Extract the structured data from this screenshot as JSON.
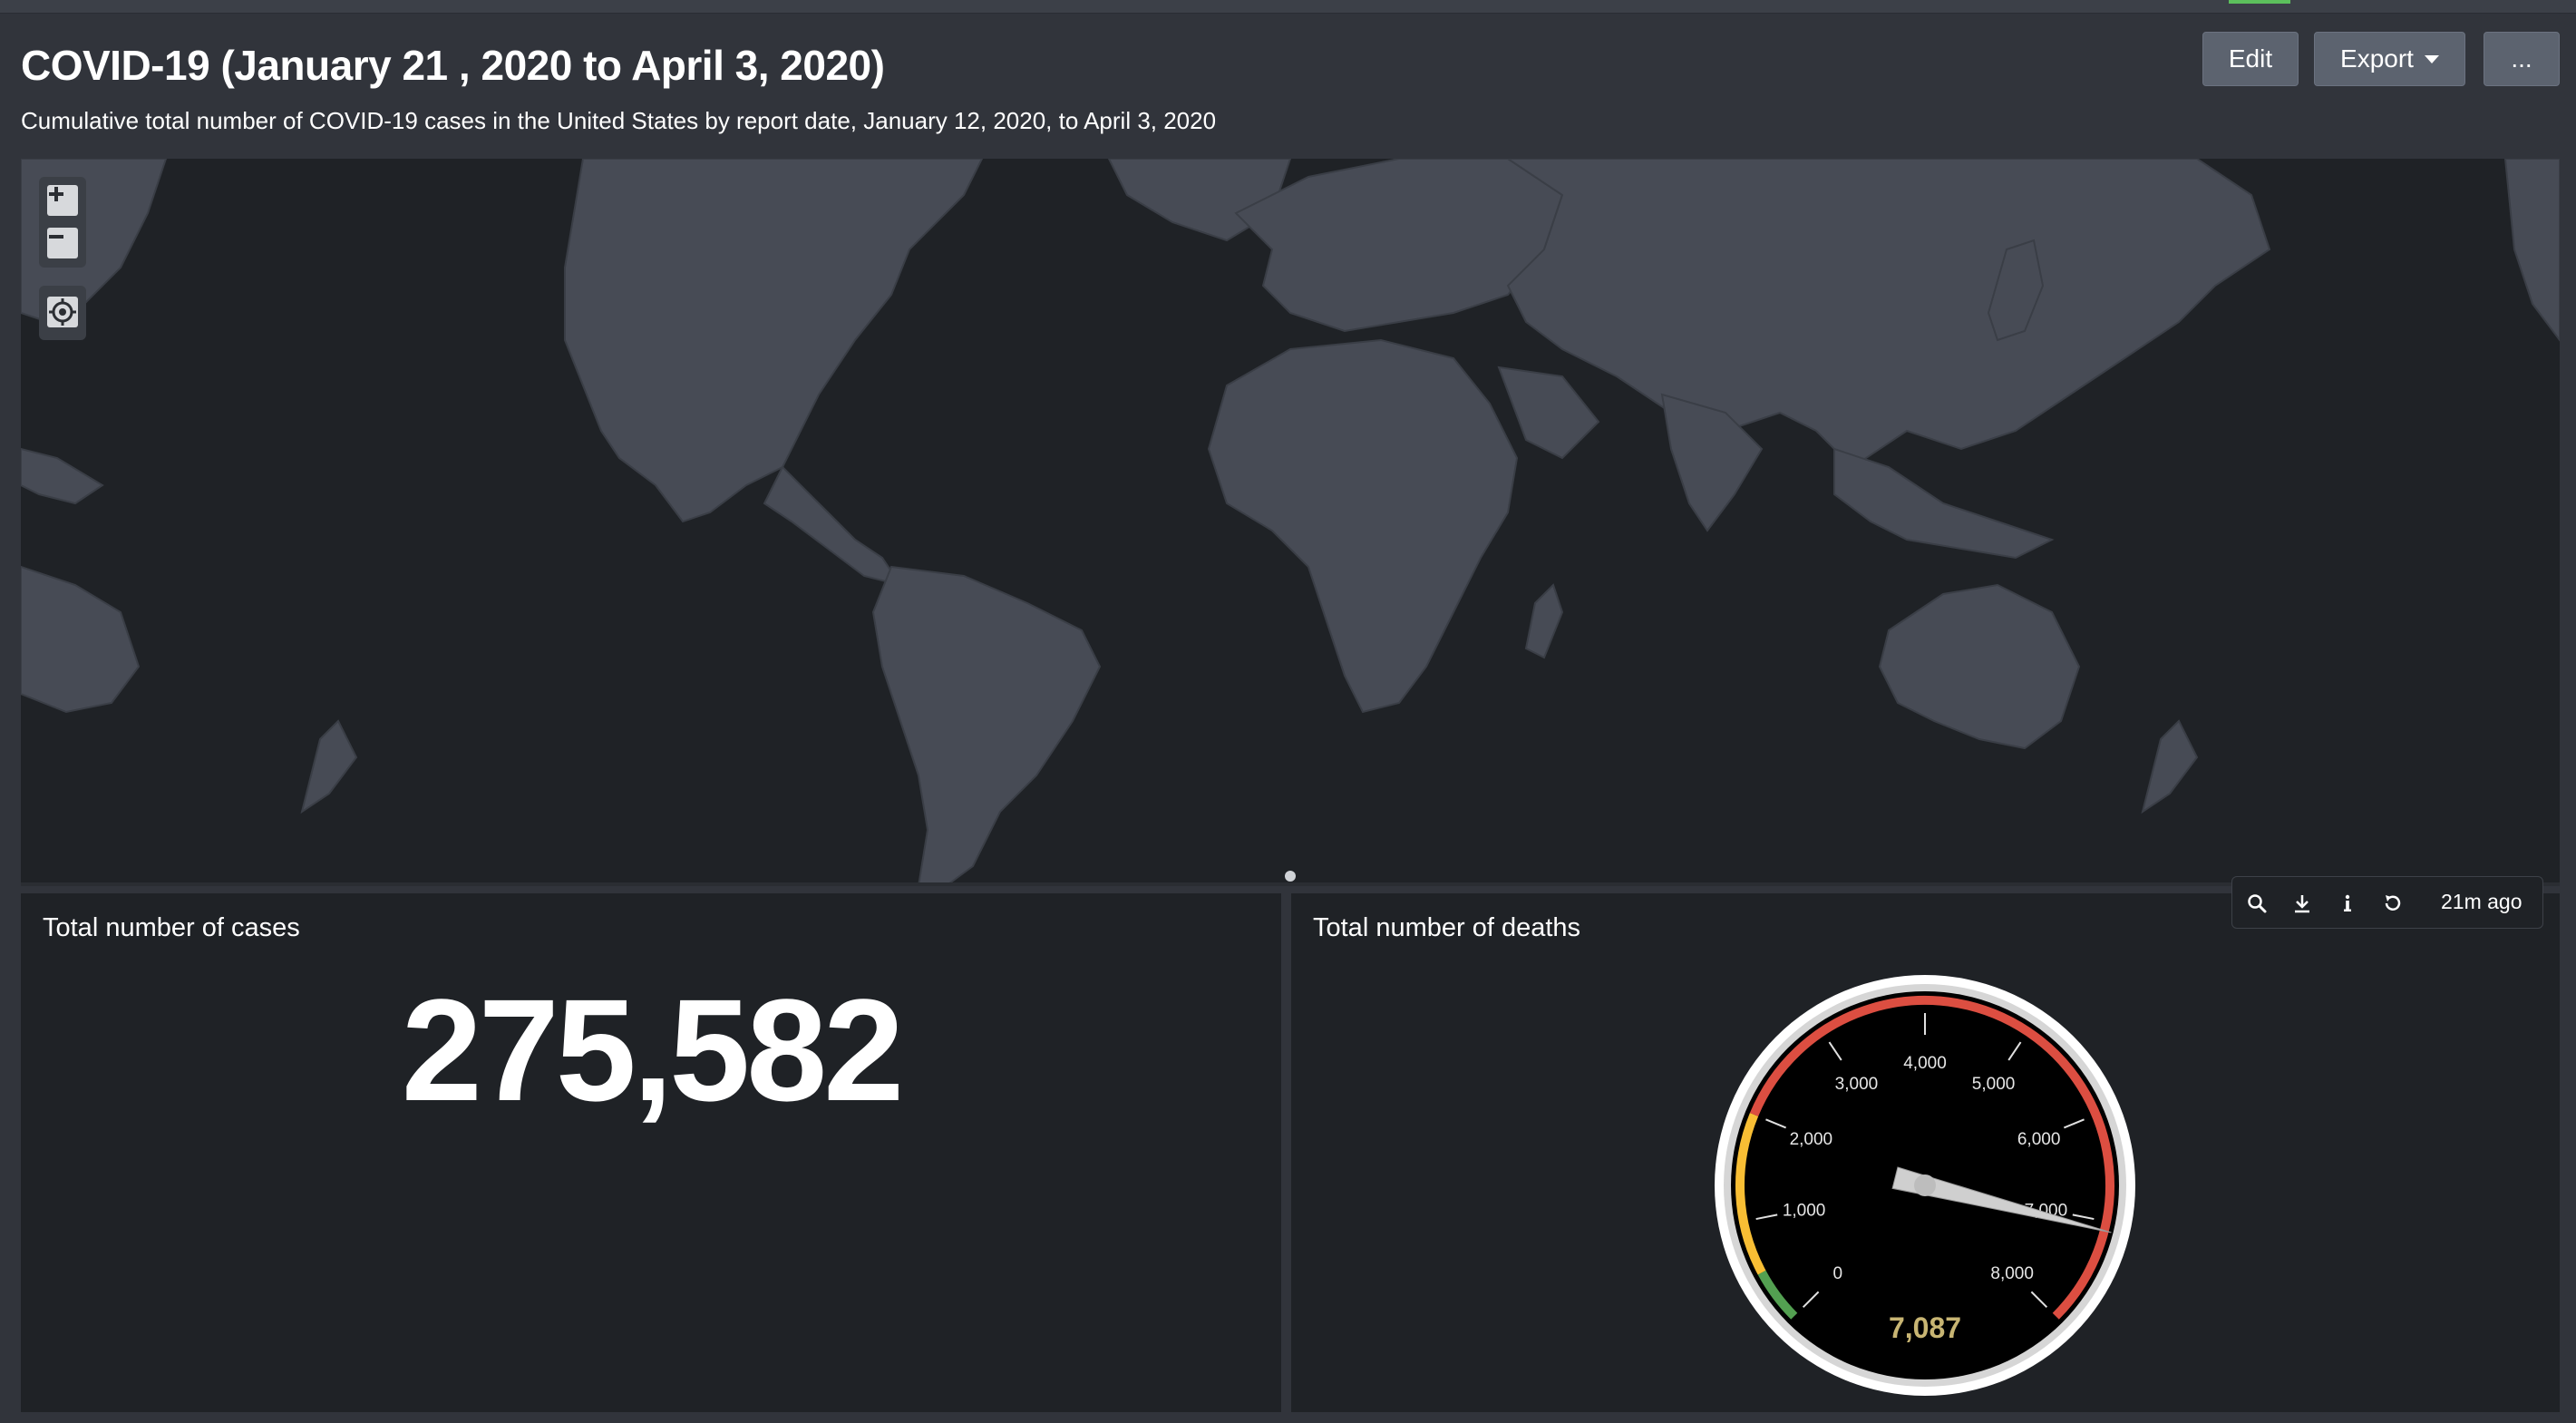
{
  "dashboard": {
    "title": "COVID-19 (January 21 , 2020 to April 3, 2020)",
    "subtitle": "Cumulative total number of COVID-19 cases in the United States by report date, January 12, 2020, to April 3, 2020"
  },
  "buttons": {
    "edit": "Edit",
    "export": "Export",
    "more": "..."
  },
  "map": {
    "zoom_in_icon": "plus-icon",
    "zoom_out_icon": "minus-icon",
    "locate_icon": "crosshair-icon"
  },
  "cases_panel": {
    "title": "Total number of cases",
    "value": "275,582"
  },
  "deaths_panel": {
    "title": "Total number of deaths",
    "value": "7,087",
    "gauge": {
      "min": 0,
      "max": 8000,
      "value": 7087,
      "ticks": [
        "0",
        "1,000",
        "2,000",
        "3,000",
        "4,000",
        "5,000",
        "6,000",
        "7,000",
        "8,000"
      ],
      "ranges": [
        {
          "from": 0,
          "to": 500,
          "color": "#53a051"
        },
        {
          "from": 500,
          "to": 2000,
          "color": "#f8be34"
        },
        {
          "from": 2000,
          "to": 8000,
          "color": "#dc4e41"
        }
      ]
    }
  },
  "toolbar": {
    "time": "21m ago",
    "icons": [
      "search-icon",
      "download-icon",
      "info-icon",
      "refresh-icon"
    ]
  },
  "colors": {
    "background": "#31343b",
    "panel": "#1f2226",
    "land": "#474b55",
    "gauge_value": "#c8b573"
  }
}
